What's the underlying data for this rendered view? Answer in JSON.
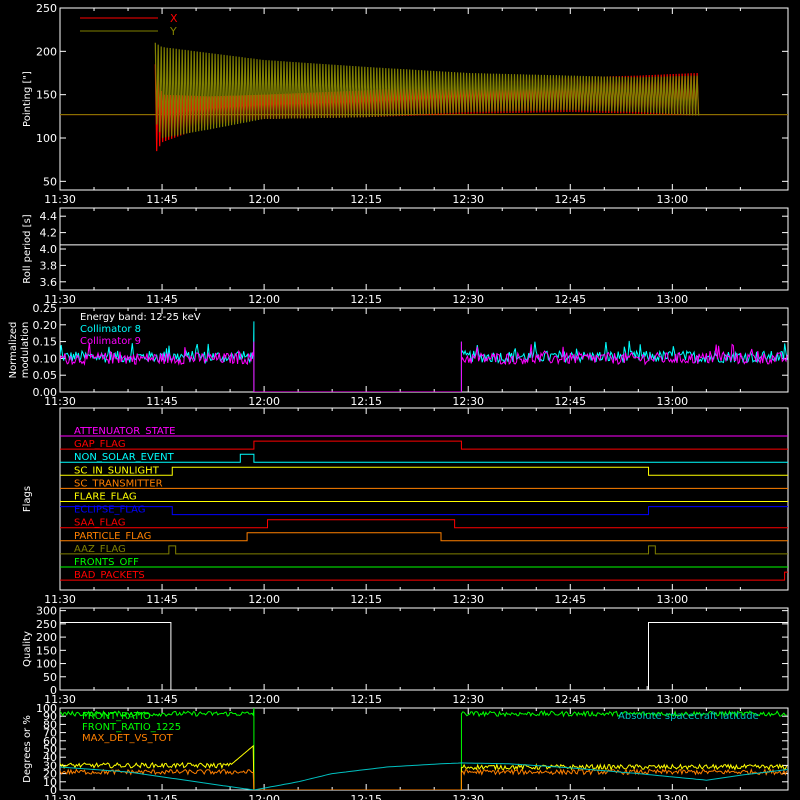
{
  "colors": {
    "background": "#000000",
    "foreground": "#ffffff",
    "x_series": "#ff0000",
    "y_series": "#808000"
  },
  "time_ticks": [
    "11:30",
    "11:45",
    "12:00",
    "12:15",
    "12:30",
    "12:45",
    "13:00"
  ],
  "chart_data": [
    {
      "type": "line",
      "panel": "pointing",
      "ylabel": "Pointing [\"]",
      "ylim": [
        40,
        250
      ],
      "yticks": [
        50,
        100,
        150,
        200,
        250
      ],
      "xlim_min": [
        0,
        107
      ],
      "legend_placement": "top-left",
      "series": [
        {
          "name": "X",
          "color": "#ff0000",
          "band_x": [
            14,
            15,
            22,
            30,
            45,
            60,
            75,
            85,
            93.5,
            94
          ],
          "band_low": [
            82,
            95,
            115,
            122,
            124,
            128,
            130,
            128,
            126,
            126
          ],
          "band_high": [
            185,
            150,
            148,
            150,
            155,
            163,
            170,
            172,
            175,
            175
          ],
          "baseline": 127
        },
        {
          "name": "Y",
          "color": "#808000",
          "band_x": [
            14,
            15,
            22,
            30,
            45,
            60,
            75,
            85,
            93.5,
            94
          ],
          "band_low": [
            120,
            100,
            110,
            122,
            124,
            130,
            132,
            130,
            126,
            126
          ],
          "band_high": [
            210,
            205,
            198,
            190,
            182,
            175,
            172,
            170,
            172,
            172
          ],
          "baseline": 127
        }
      ]
    },
    {
      "type": "line",
      "panel": "roll-period",
      "ylabel": "Roll period [s]",
      "ylim": [
        3.5,
        4.5
      ],
      "yticks": [
        3.6,
        3.8,
        4.0,
        4.2,
        4.4
      ],
      "series": [
        {
          "name": "",
          "color": "#ffffff",
          "x": [
            0,
            107
          ],
          "y": [
            4.05,
            4.05
          ]
        }
      ]
    },
    {
      "type": "line",
      "panel": "modulation",
      "ylabel": "Normalized modulation",
      "ylim": [
        0,
        0.25
      ],
      "yticks": [
        0.0,
        0.05,
        0.1,
        0.15,
        0.2,
        0.25
      ],
      "annotation": "Energy band: 12-25 keV",
      "series": [
        {
          "name": "Collimator 8",
          "color": "#00ffff",
          "segments": [
            {
              "x0": 0,
              "x1": 28.5,
              "mean": 0.105
            },
            {
              "x0": 59,
              "x1": 107,
              "mean": 0.105
            }
          ],
          "gap_level": 0.0
        },
        {
          "name": "Collimator 9",
          "color": "#ff00ff",
          "segments": [
            {
              "x0": 0,
              "x1": 28.5,
              "mean": 0.1
            },
            {
              "x0": 59,
              "x1": 107,
              "mean": 0.1
            }
          ],
          "gap_level": 0.0
        }
      ]
    },
    {
      "type": "line",
      "panel": "flags",
      "ylabel": "Flags",
      "series": [
        {
          "name": "ATTENUATOR_STATE",
          "color": "#ff00ff",
          "steps": [
            [
              0,
              0
            ]
          ]
        },
        {
          "name": "GAP_FLAG",
          "color": "#ff0000",
          "steps": [
            [
              0,
              0
            ],
            [
              28.5,
              1
            ],
            [
              59,
              0
            ]
          ]
        },
        {
          "name": "NON_SOLAR_EVENT",
          "color": "#00ffff",
          "steps": [
            [
              0,
              0
            ],
            [
              26.5,
              1
            ],
            [
              28.5,
              0
            ]
          ]
        },
        {
          "name": "SC_IN_SUNLIGHT",
          "color": "#ffff00",
          "steps": [
            [
              0,
              0
            ],
            [
              16.5,
              1
            ],
            [
              86.5,
              0
            ]
          ]
        },
        {
          "name": "SC_TRANSMITTER",
          "color": "#ff8000",
          "steps": [
            [
              0,
              0
            ]
          ]
        },
        {
          "name": "FLARE_FLAG",
          "color": "#ffff00",
          "steps": [
            [
              0,
              0
            ]
          ]
        },
        {
          "name": "ECLIPSE_FLAG",
          "color": "#0000ff",
          "steps": [
            [
              0,
              1
            ],
            [
              16.5,
              0
            ],
            [
              86.5,
              1
            ]
          ]
        },
        {
          "name": "SAA_FLAG",
          "color": "#ff0000",
          "steps": [
            [
              0,
              0
            ],
            [
              30.5,
              1
            ],
            [
              58,
              0
            ]
          ]
        },
        {
          "name": "PARTICLE_FLAG",
          "color": "#ff8000",
          "steps": [
            [
              0,
              0
            ],
            [
              27.5,
              1
            ],
            [
              56,
              0
            ]
          ]
        },
        {
          "name": "AAZ_FLAG",
          "color": "#808000",
          "steps": [
            [
              0,
              0
            ],
            [
              16,
              1
            ],
            [
              17,
              0
            ],
            [
              86.5,
              1
            ],
            [
              87.5,
              0
            ]
          ]
        },
        {
          "name": "FRONTS_OFF",
          "color": "#00ff00",
          "steps": [
            [
              0,
              0
            ]
          ]
        },
        {
          "name": "BAD_PACKETS",
          "color": "#ff0000",
          "steps": [
            [
              0,
              0
            ],
            [
              106.5,
              1
            ]
          ]
        }
      ]
    },
    {
      "type": "line",
      "panel": "quality",
      "ylabel": "Quality",
      "ylim": [
        0,
        310
      ],
      "yticks": [
        0,
        50,
        100,
        150,
        200,
        250,
        300
      ],
      "series": [
        {
          "name": "",
          "color": "#ffffff",
          "x": [
            0,
            16.3,
            16.3,
            86.5,
            86.5,
            107
          ],
          "y": [
            255,
            255,
            0,
            0,
            255,
            255
          ]
        }
      ]
    },
    {
      "type": "line",
      "panel": "ratios",
      "ylabel": "Degrees or %",
      "ylim": [
        0,
        100
      ],
      "yticks": [
        0,
        10,
        20,
        30,
        40,
        50,
        60,
        70,
        80,
        90,
        100
      ],
      "annotations": [
        "Absolute spacecraft latitude"
      ],
      "series": [
        {
          "name": "FRONT_RATIO",
          "color": "#00ff00",
          "segments": [
            {
              "x0": 0,
              "x1": 28.5,
              "mean": 93
            },
            {
              "x0": 59,
              "x1": 107,
              "mean": 93
            }
          ]
        },
        {
          "name": "FRONT_RATIO_1225",
          "color": "#ffff00",
          "segments": [
            {
              "x0": 0,
              "x1": 28.5,
              "mean": 30
            },
            {
              "x0": 59,
              "x1": 107,
              "mean": 28
            }
          ]
        },
        {
          "name": "MAX_DET_VS_TOT",
          "color": "#ff8000",
          "segments": [
            {
              "x0": 0,
              "x1": 28.5,
              "mean": 22
            },
            {
              "x0": 59,
              "x1": 107,
              "mean": 22
            }
          ]
        },
        {
          "name": "Absolute spacecraft latitude",
          "color": "#00c0c0",
          "x": [
            0,
            10,
            20,
            28.5,
            35,
            40,
            48,
            56,
            59,
            66,
            75,
            85,
            95,
            100,
            107
          ],
          "y": [
            28,
            22,
            10,
            0,
            10,
            20,
            28,
            32,
            33,
            32,
            27,
            20,
            12,
            18,
            25
          ]
        }
      ]
    }
  ]
}
